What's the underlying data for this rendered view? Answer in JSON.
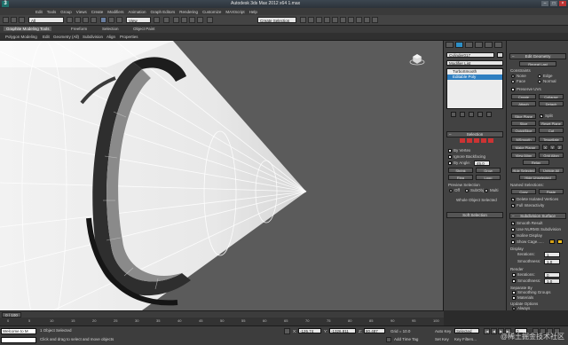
{
  "window": {
    "title": "Autodesk 3ds Max 2012 x64    1.max",
    "logo": "3"
  },
  "menu": [
    "Edit",
    "Tools",
    "Group",
    "Views",
    "Create",
    "Modifiers",
    "Animation",
    "Graph Editors",
    "Rendering",
    "Customize",
    "MAXScript",
    "Help"
  ],
  "toolbar": {
    "selection_filter": "All",
    "view_dropdown": "View",
    "named_selection": "Create Selection Se"
  },
  "ribbon": {
    "tabs": [
      "Graphite Modeling Tools",
      "Freeform",
      "Selection",
      "Object Paint"
    ],
    "subtabs": [
      "Polygon Modeling",
      "Edit",
      "Geometry (All)",
      "Subdivision",
      "Align",
      "Properties"
    ]
  },
  "command_panel": {
    "object_name": "Cylinder017",
    "modifier_list": "Modifier List",
    "stack": [
      "TurboSmooth",
      "Editable Poly"
    ],
    "selection_title": "Selection",
    "by_vertex": "By Vertex",
    "ignore_backfacing": "Ignore Backfacing",
    "by_angle": "By Angle:",
    "by_angle_value": "45.0",
    "shrink": "Shrink",
    "grow": "Grow",
    "ring": "Ring",
    "loop": "Loop",
    "preview_selection": "Preview Selection",
    "preview_options": [
      "Off",
      "SubObj",
      "Multi"
    ],
    "whole_selected": "Whole Object Selected",
    "soft_selection": "Soft Selection"
  },
  "edit_panel": {
    "edit_geometry": "Edit Geometry",
    "repeat_last": "Repeat Last",
    "constraints": "Constraints",
    "constraint_options": [
      "None",
      "Edge",
      "Face",
      "Normal"
    ],
    "preserve_uvs": "Preserve UVs",
    "create": "Create",
    "collapse": "Collapse",
    "attach": "Attach",
    "detach": "Detach",
    "slice_plane": "Slice Plane",
    "split": "Split",
    "slice": "Slice",
    "reset_plane": "Reset Plane",
    "quickslice": "QuickSlice",
    "cut": "Cut",
    "msmooth": "MSmooth",
    "tessellate": "Tessellate",
    "make_planar": "Make Planar",
    "xyz": [
      "X",
      "Y",
      "Z"
    ],
    "view_align": "View Align",
    "grid_align": "Grid Align",
    "relax": "Relax",
    "hide_selected": "Hide Selected",
    "unhide_all": "Unhide All",
    "hide_unselected": "Hide Unselected",
    "named_selections": "Named Selections:",
    "copy": "Copy",
    "paste": "Paste",
    "delete_isolated": "Delete Isolated Vertices",
    "full_interactivity": "Full Interactivity",
    "subdivision_surface": "Subdivision Surface",
    "smooth_result": "Smooth Result",
    "use_nurms": "Use NURMS Subdivision",
    "isoline_display": "Isoline Display",
    "show_cage": "Show Cage......",
    "display": "Display",
    "iterations": "Iterations:",
    "iterations_value": "1",
    "smoothness": "Smoothness:",
    "smoothness_value": "1.0",
    "render": "Render",
    "render_iterations_value": "0",
    "render_smoothness_value": "1.0",
    "separate_by": "Separate By",
    "smoothing_groups": "Smoothing Groups",
    "materials": "Materials",
    "update_options": "Update Options",
    "always": "Always",
    "when_rendering": "When Rendering",
    "manually": "Manually",
    "cage_colors": [
      "#d4a017",
      "#f0c020"
    ]
  },
  "timeline": {
    "frame": "0 / 100",
    "ticks": [
      "0",
      "5",
      "10",
      "15",
      "20",
      "25",
      "30",
      "35",
      "40",
      "45",
      "50",
      "55",
      "60",
      "65",
      "70",
      "75",
      "80",
      "85",
      "90",
      "95",
      "100"
    ]
  },
  "status": {
    "maxscript": "Welcome to M",
    "selected": "1 Object Selected",
    "prompt": "Click and drag to select and move objects",
    "x_label": "X:",
    "x_value": "-126.74",
    "y_label": "Y:",
    "y_value": "-1326.811",
    "z_label": "Z:",
    "z_value": "80.487",
    "grid": "Grid = 10.0",
    "auto_key": "Auto Key",
    "set_key": "Set Key",
    "selected_dropdown": "Selected",
    "key_filters": "Key Filters...",
    "add_time_tag": "Add Time Tag",
    "frame_value": "0"
  },
  "watermark": "@稀土掘金技术社区"
}
